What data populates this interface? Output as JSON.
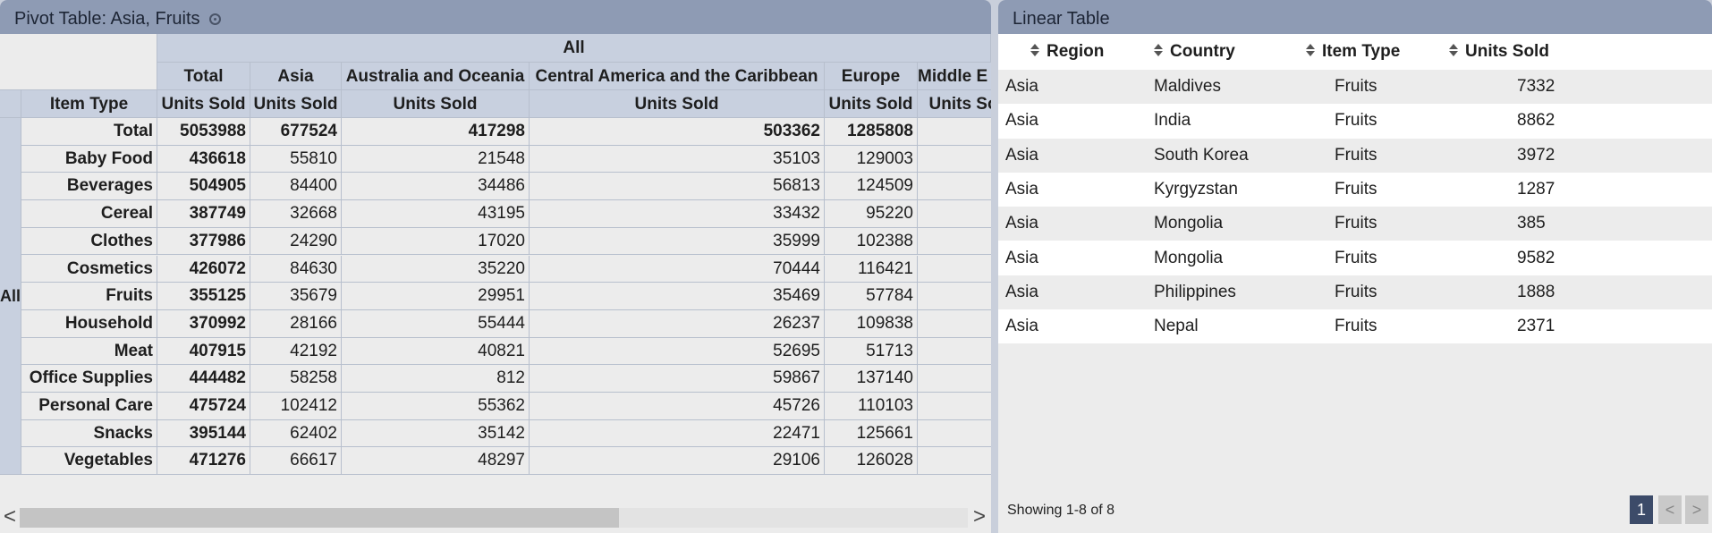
{
  "pivot": {
    "title": "Pivot Table: Asia, Fruits",
    "col_group": "All",
    "columns": [
      "Total",
      "Asia",
      "Australia and Oceania",
      "Central America and the Caribbean",
      "Europe",
      "Middle E"
    ],
    "measure": "Units Sold",
    "row_group": "All",
    "row_header": "Item Type",
    "rows": [
      {
        "label": "Total",
        "values": [
          "5053988",
          "677524",
          "417298",
          "503362",
          "1285808"
        ]
      },
      {
        "label": "Baby Food",
        "values": [
          "436618",
          "55810",
          "21548",
          "35103",
          "129003"
        ]
      },
      {
        "label": "Beverages",
        "values": [
          "504905",
          "84400",
          "34486",
          "56813",
          "124509"
        ]
      },
      {
        "label": "Cereal",
        "values": [
          "387749",
          "32668",
          "43195",
          "33432",
          "95220"
        ]
      },
      {
        "label": "Clothes",
        "values": [
          "377986",
          "24290",
          "17020",
          "35999",
          "102388"
        ]
      },
      {
        "label": "Cosmetics",
        "values": [
          "426072",
          "84630",
          "35220",
          "70444",
          "116421"
        ]
      },
      {
        "label": "Fruits",
        "values": [
          "355125",
          "35679",
          "29951",
          "35469",
          "57784"
        ]
      },
      {
        "label": "Household",
        "values": [
          "370992",
          "28166",
          "55444",
          "26237",
          "109838"
        ]
      },
      {
        "label": "Meat",
        "values": [
          "407915",
          "42192",
          "40821",
          "52695",
          "51713"
        ]
      },
      {
        "label": "Office Supplies",
        "values": [
          "444482",
          "58258",
          "812",
          "59867",
          "137140"
        ]
      },
      {
        "label": "Personal Care",
        "values": [
          "475724",
          "102412",
          "55362",
          "45726",
          "110103"
        ]
      },
      {
        "label": "Snacks",
        "values": [
          "395144",
          "62402",
          "35142",
          "22471",
          "125661"
        ]
      },
      {
        "label": "Vegetables",
        "values": [
          "471276",
          "66617",
          "48297",
          "29106",
          "126028"
        ]
      }
    ],
    "scroll_left": "<",
    "scroll_right": ">"
  },
  "linear": {
    "title": "Linear Table",
    "headers": [
      "Region",
      "Country",
      "Item Type",
      "Units Sold"
    ],
    "rows": [
      [
        "Asia",
        "Maldives",
        "Fruits",
        "7332"
      ],
      [
        "Asia",
        "India",
        "Fruits",
        "8862"
      ],
      [
        "Asia",
        "South Korea",
        "Fruits",
        "3972"
      ],
      [
        "Asia",
        "Kyrgyzstan",
        "Fruits",
        "1287"
      ],
      [
        "Asia",
        "Mongolia",
        "Fruits",
        "385"
      ],
      [
        "Asia",
        "Mongolia",
        "Fruits",
        "9582"
      ],
      [
        "Asia",
        "Philippines",
        "Fruits",
        "1888"
      ],
      [
        "Asia",
        "Nepal",
        "Fruits",
        "2371"
      ]
    ],
    "footer": "Showing 1-8 of 8",
    "pager": {
      "current": "1",
      "prev": "<",
      "next": ">"
    }
  }
}
